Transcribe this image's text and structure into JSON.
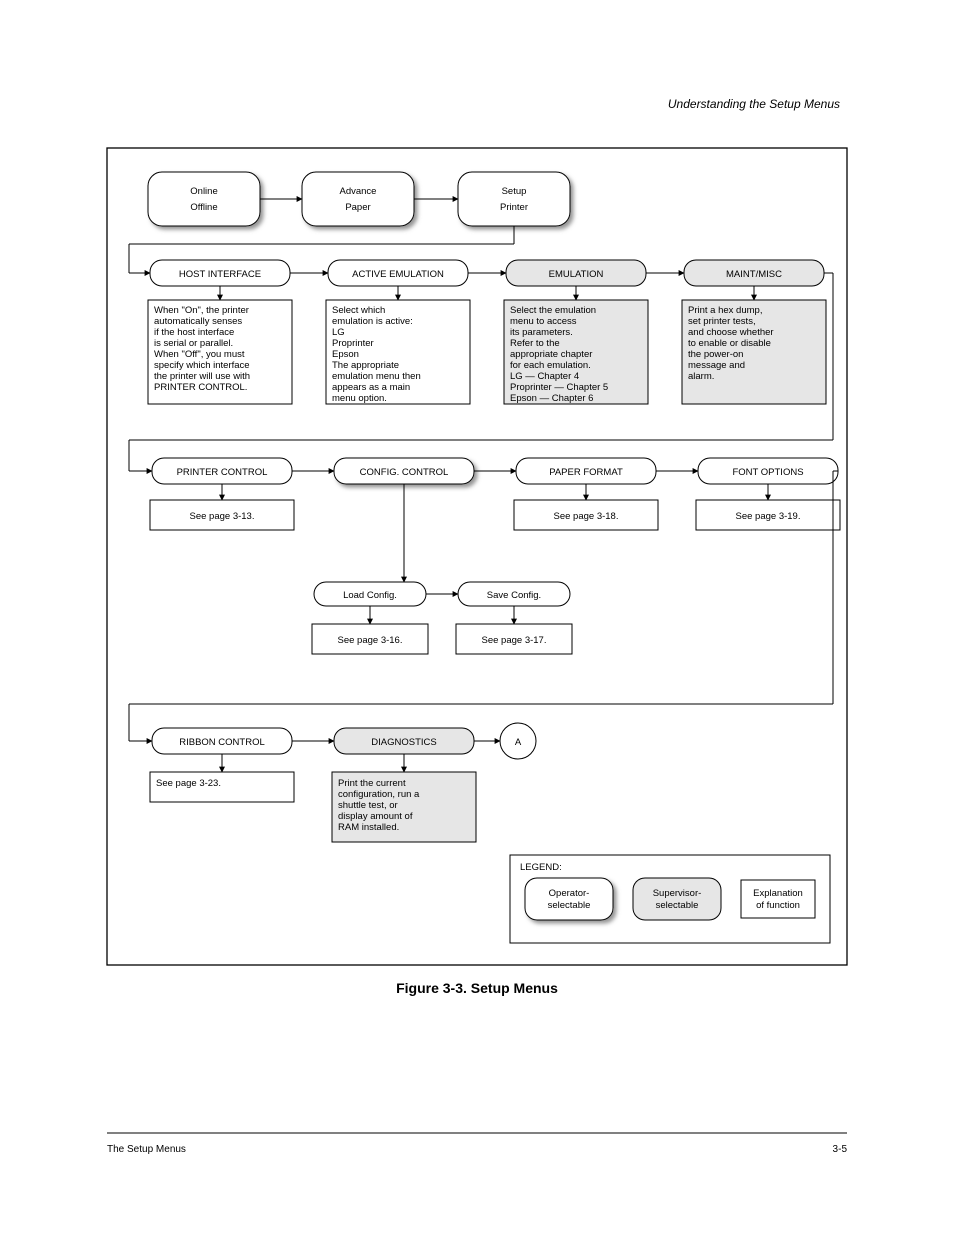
{
  "header_right": "Understanding the Setup Menus",
  "figure_caption": "Figure 3-3.  Setup Menus",
  "top_row": [
    {
      "l1": "Online",
      "l2": "Offline"
    },
    {
      "l1": "Advance",
      "l2": "Paper"
    },
    {
      "l1": "Setup",
      "l2": "Printer"
    }
  ],
  "row2": [
    {
      "title": "HOST INTERFACE",
      "shaded": false,
      "panel": [
        "When \"On\", the printer",
        "automatically senses",
        "if the host interface",
        "is serial or parallel.",
        "When \"Off\", you must",
        "specify which interface",
        "the printer will use with",
        "PRINTER CONTROL."
      ]
    },
    {
      "title": "ACTIVE EMULATION",
      "shaded": false,
      "panel": [
        "Select which",
        "emulation is active:",
        "  LG",
        "  Proprinter",
        "  Epson",
        "The appropriate",
        "emulation menu then",
        "appears as a main",
        "menu option."
      ]
    },
    {
      "title": "EMULATION",
      "shaded": true,
      "panel": [
        "Select the emulation",
        "menu to access",
        "its parameters.",
        "Refer to the",
        "appropriate chapter",
        "for each emulation.",
        "  LG — Chapter 4",
        "  Proprinter — Chapter 5",
        "  Epson — Chapter 6"
      ]
    },
    {
      "title": "MAINT/MISC",
      "shaded": true,
      "panel": [
        "Print a hex dump,",
        "set printer tests,",
        "and choose whether",
        "to enable or disable",
        "the power-on",
        "message and",
        "alarm."
      ]
    }
  ],
  "row3": [
    {
      "title": "PRINTER CONTROL",
      "shaded": false,
      "panel": [
        "See page 3-13."
      ]
    },
    {
      "title": "CONFIG. CONTROL",
      "shaded": false,
      "panel": []
    },
    {
      "title": "PAPER FORMAT",
      "shaded": false,
      "panel": [
        "See page 3-18."
      ]
    },
    {
      "title": "FONT OPTIONS",
      "shaded": false,
      "panel": [
        "See page 3-19."
      ]
    }
  ],
  "sub_config": [
    {
      "title": "Load Config.",
      "panel": [
        "See page 3-16."
      ]
    },
    {
      "title": "Save Config.",
      "panel": [
        "See page 3-17."
      ]
    }
  ],
  "row4": [
    {
      "title": "RIBBON CONTROL",
      "shaded": false,
      "panel": [
        "See page 3-23."
      ]
    },
    {
      "title": "DIAGNOSTICS",
      "shaded": true,
      "panel": [
        "Print the current",
        "configuration, run a",
        "shuttle test, or",
        "display amount of",
        "RAM installed."
      ]
    }
  ],
  "circle_label": "A",
  "legend": {
    "title": "LEGEND:",
    "items": [
      {
        "kind": "rounded-shadow",
        "l1": "Operator-",
        "l2": "selectable"
      },
      {
        "kind": "rounded-gray",
        "l1": "Supervisor-",
        "l2": "selectable"
      },
      {
        "kind": "rect",
        "l1": "Explanation",
        "l2": "of function"
      }
    ]
  },
  "footer_left": "The Setup Menus",
  "footer_right": "3-5"
}
